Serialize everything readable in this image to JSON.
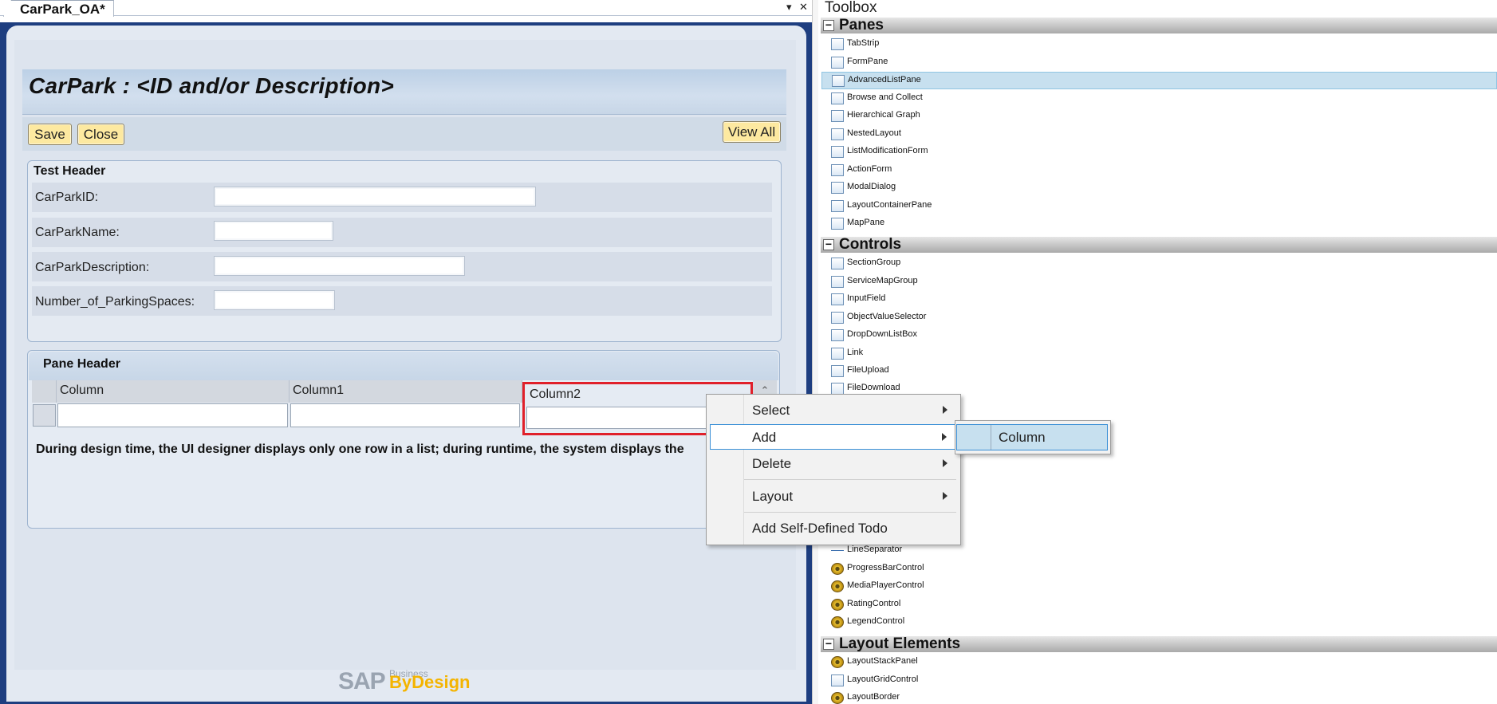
{
  "tab": {
    "label": "CarPark_OA*",
    "pin": "▾",
    "close": "✕"
  },
  "form": {
    "title": "CarPark : <ID and/or Description>",
    "buttons": {
      "save": "Save",
      "close": "Close",
      "view_all": "View All"
    },
    "group_title": "Test Header",
    "fields": [
      {
        "label": "CarParkID:"
      },
      {
        "label": "CarParkName:"
      },
      {
        "label": "CarParkDescription:"
      },
      {
        "label": "Number_of_ParkingSpaces:"
      }
    ],
    "pane_title": "Pane Header",
    "columns": [
      "Column",
      "Column1",
      "Column2"
    ],
    "design_note": "During design time, the UI designer displays only one row in a list; during runtime, the system displays the"
  },
  "brand": {
    "sap": "SAP",
    "business": "Business",
    "bydesign": "ByDesign"
  },
  "toolbox": {
    "title": "Toolbox",
    "sections": {
      "panes": {
        "title": "Panes",
        "toggle": "−",
        "items": [
          "TabStrip",
          "FormPane",
          "AdvancedListPane",
          "Browse and Collect",
          "Hierarchical Graph",
          "NestedLayout",
          "ListModificationForm",
          "ActionForm",
          "ModalDialog",
          "LayoutContainerPane",
          "MapPane"
        ]
      },
      "controls": {
        "title": "Controls",
        "toggle": "−",
        "items": [
          "SectionGroup",
          "ServiceMapGroup",
          "InputField",
          "ObjectValueSelector",
          "DropDownListBox",
          "Link",
          "FileUpload",
          "FileDownload"
        ],
        "items_below": [
          "LineSeparator",
          "ProgressBarControl",
          "MediaPlayerControl",
          "RatingControl",
          "LegendControl"
        ]
      },
      "layout": {
        "title": "Layout Elements",
        "toggle": "−",
        "items": [
          "LayoutStackPanel",
          "LayoutGridControl",
          "LayoutBorder"
        ]
      }
    },
    "selected": "AdvancedListPane"
  },
  "context_menu": {
    "items": [
      "Select",
      "Add",
      "Delete",
      "Layout",
      "Add Self-Defined Todo"
    ],
    "highlighted": "Add",
    "submenu": [
      "Column"
    ]
  },
  "colors": {
    "accent": "#3a8fd6",
    "frame": "#1e3e80",
    "button": "#fde9a0",
    "selection": "#c7e0ef",
    "column_highlight": "#e0202a"
  }
}
